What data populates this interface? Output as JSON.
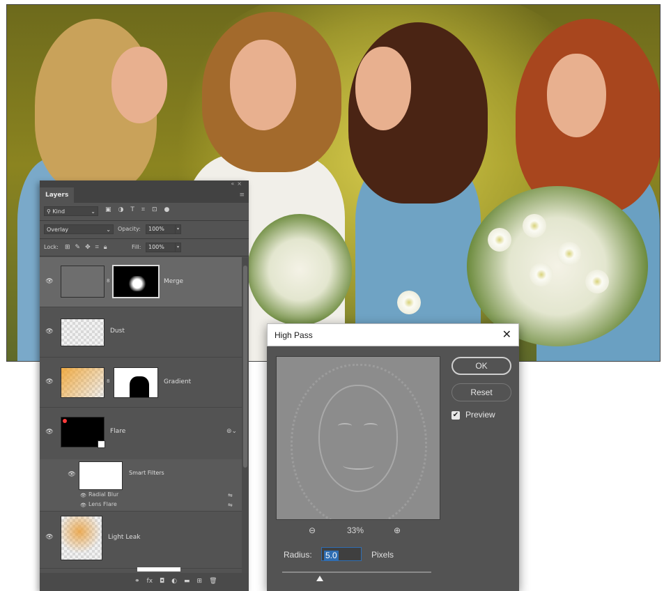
{
  "layers_panel": {
    "tab_label": "Layers",
    "filter_kind": "Kind",
    "blend_mode": "Overlay",
    "opacity_label": "Opacity:",
    "opacity_value": "100%",
    "lock_label": "Lock:",
    "fill_label": "Fill:",
    "fill_value": "100%",
    "layers": [
      {
        "name": "Merge",
        "selected": true
      },
      {
        "name": "Dust"
      },
      {
        "name": "Gradient"
      },
      {
        "name": "Flare"
      },
      {
        "name": "Smart Filters"
      },
      {
        "name": "Radial Blur"
      },
      {
        "name": "Lens Flare"
      },
      {
        "name": "Light Leak"
      }
    ]
  },
  "high_pass_dialog": {
    "title": "High Pass",
    "ok_label": "OK",
    "reset_label": "Reset",
    "preview_label": "Preview",
    "preview_checked": true,
    "zoom_level": "33%",
    "radius_label": "Radius:",
    "radius_value": "5.0",
    "radius_unit": "Pixels"
  },
  "colors": {
    "panel_bg": "#535353",
    "selection_blue": "#2f6eb3",
    "dress_blue": "#6fa3c4"
  }
}
